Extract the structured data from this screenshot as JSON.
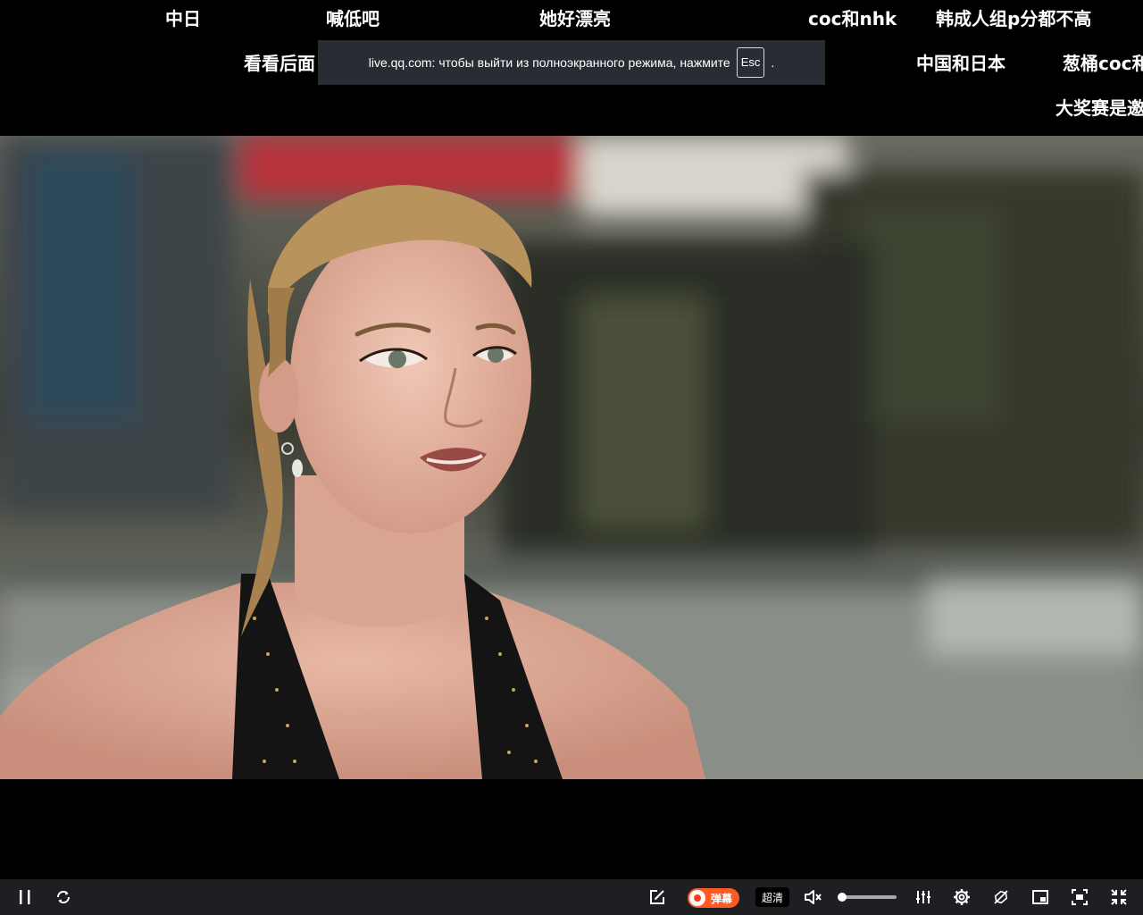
{
  "danmaku": [
    "中日",
    "喊低吧",
    "她好漂亮",
    "coc和nhk",
    "韩成人组p分都不高",
    "看看后面",
    "中国和日本",
    "葱桶coc和",
    "大奖赛是邀"
  ],
  "fullscreen_notice": {
    "text": "live.qq.com: чтобы выйти из полноэкранного режима, нажмите",
    "key": "Esc",
    "suffix": "."
  },
  "controls": {
    "pause_icon": "pause-icon",
    "refresh_icon": "refresh-icon",
    "send_danmaku_icon": "edit-icon",
    "danmaku_toggle_label": "弹幕",
    "danmaku_enabled": true,
    "quality_label": "超清",
    "mute_icon": "volume-mute-icon",
    "volume_level": 0.05,
    "mixer_icon": "sliders-icon",
    "settings_icon": "gear-icon",
    "block_icon": "block-icon",
    "pip_icon": "picture-in-picture-icon",
    "webfullscreen_icon": "web-fullscreen-icon",
    "exit_fullscreen_icon": "exit-fullscreen-icon",
    "accent_color": "#ff5a26"
  }
}
